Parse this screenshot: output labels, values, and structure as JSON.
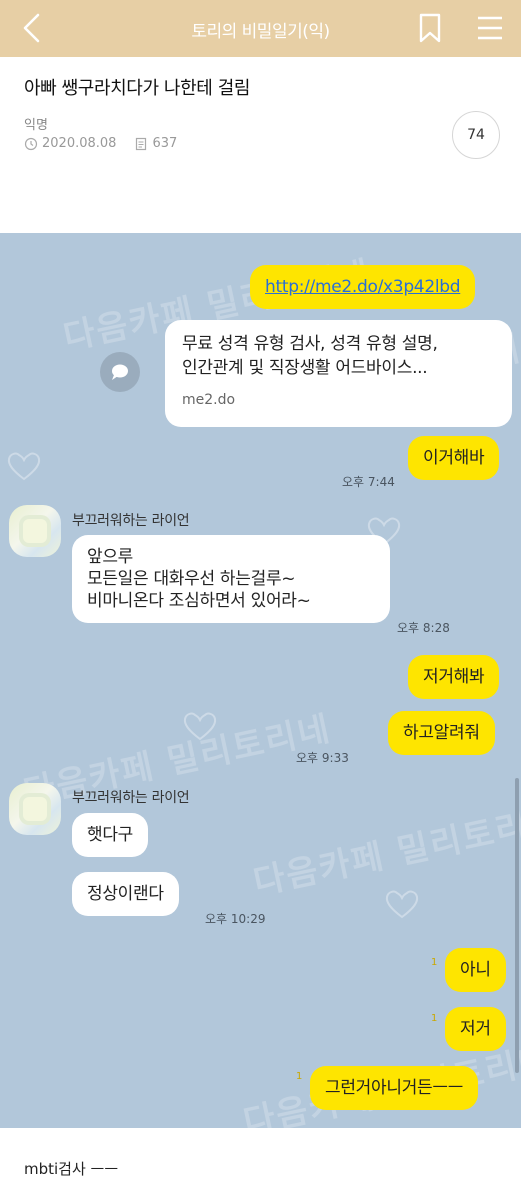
{
  "header": {
    "title": "토리의 비밀일기(익)"
  },
  "post": {
    "title": "아빠 쌩구라치다가 나한테 걸림",
    "author": "익명",
    "date": "2020.08.08",
    "views": "637",
    "comments": "74"
  },
  "watermark": {
    "text": "다음카페 밀리토리네"
  },
  "chat": {
    "messages": [
      {
        "side": "right",
        "text": "http://me2.do/x3p42lbd"
      },
      {
        "side": "right",
        "type": "link-card",
        "line1": "무료 성격 유형 검사, 성격 유형 설명,",
        "line2": "인간관계 및 직장생활 어드바이스...",
        "domain": "me2.do"
      },
      {
        "side": "right",
        "text": "이거해바",
        "time": "오후 7:44"
      },
      {
        "side": "left",
        "sender": "부끄러워하는 라이언",
        "line1": "앞으루",
        "line2": "모든일은  대화우선 하는걸루~",
        "line3": "비마니온다   조심하면서 있어라~",
        "time": "오후 8:28"
      },
      {
        "side": "right",
        "text": "저거해봐"
      },
      {
        "side": "right",
        "text": "하고알려줘",
        "time": "오후 9:33"
      },
      {
        "side": "left",
        "sender": "부끄러워하는 라이언",
        "text": "햇다구"
      },
      {
        "side": "left",
        "text": "정상이랜다",
        "time": "오후 10:29"
      },
      {
        "side": "right",
        "text": "아니",
        "unread": "1"
      },
      {
        "side": "right",
        "text": "저거",
        "unread": "1"
      },
      {
        "side": "right",
        "text": "그런거아니거든ㅡㅡ",
        "unread": "1"
      }
    ]
  },
  "footer": {
    "text": "mbti검사 ㅡㅡ"
  },
  "colors": {
    "header_bg": "#e7cfa5",
    "chat_bg": "#b2c7da",
    "my_bubble": "#fee500",
    "their_bubble": "#ffffff",
    "link": "#2a6fd6"
  }
}
